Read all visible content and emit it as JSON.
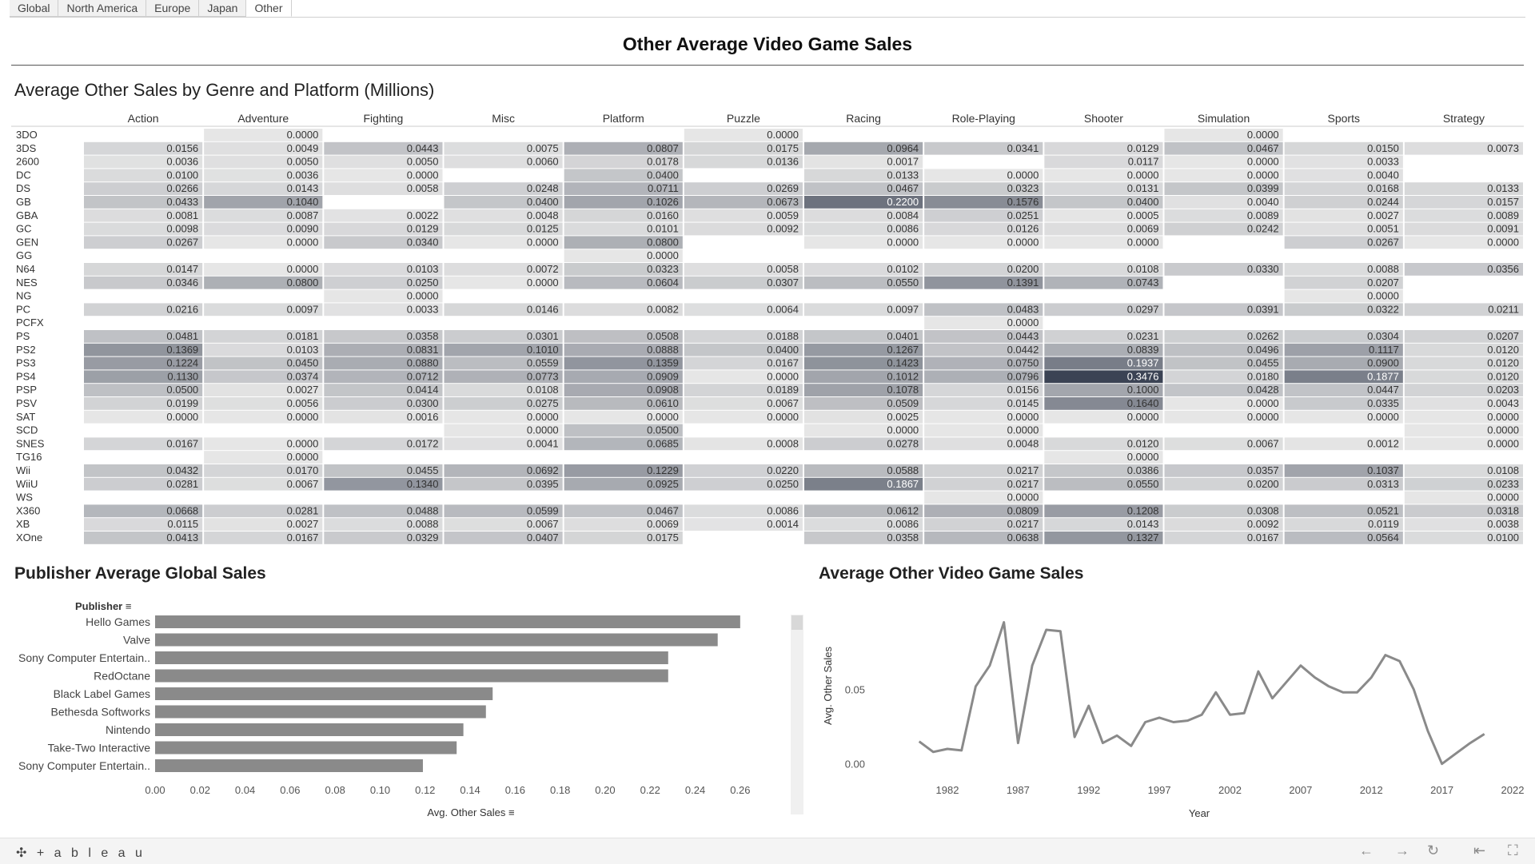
{
  "tabs": [
    "Global",
    "North America",
    "Europe",
    "Japan",
    "Other"
  ],
  "active_tab": 4,
  "dashboard_title": "Other Average Video Game Sales",
  "footer": {
    "logo": "+ a b l e a u",
    "logo_mark": "✣"
  },
  "chart_data": [
    {
      "type": "heatmap",
      "title": "Average Other Sales by Genre and Platform (Millions)",
      "columns": [
        "Action",
        "Adventure",
        "Fighting",
        "Misc",
        "Platform",
        "Puzzle",
        "Racing",
        "Role-Playing",
        "Shooter",
        "Simulation",
        "Sports",
        "Strategy"
      ],
      "rows": [
        "3DO",
        "3DS",
        "2600",
        "DC",
        "DS",
        "GB",
        "GBA",
        "GC",
        "GEN",
        "GG",
        "N64",
        "NES",
        "NG",
        "PC",
        "PCFX",
        "PS",
        "PS2",
        "PS3",
        "PS4",
        "PSP",
        "PSV",
        "SAT",
        "SCD",
        "SNES",
        "TG16",
        "Wii",
        "WiiU",
        "WS",
        "X360",
        "XB",
        "XOne"
      ],
      "values": [
        [
          null,
          0.0,
          null,
          null,
          null,
          0.0,
          null,
          null,
          null,
          0.0,
          null,
          null
        ],
        [
          0.0156,
          0.0049,
          0.0443,
          0.0075,
          0.0807,
          0.0175,
          0.0964,
          0.0341,
          0.0129,
          0.0467,
          0.015,
          0.0073
        ],
        [
          0.0036,
          0.005,
          0.005,
          0.006,
          0.0178,
          0.0136,
          0.0017,
          null,
          0.0117,
          0.0,
          0.0033,
          null
        ],
        [
          0.01,
          0.0036,
          0.0,
          null,
          0.04,
          null,
          0.0133,
          0.0,
          0.0,
          0.0,
          0.004,
          null
        ],
        [
          0.0266,
          0.0143,
          0.0058,
          0.0248,
          0.0711,
          0.0269,
          0.0467,
          0.0323,
          0.0131,
          0.0399,
          0.0168,
          0.0133
        ],
        [
          0.0433,
          0.104,
          null,
          0.04,
          0.1026,
          0.0673,
          0.22,
          0.1576,
          0.04,
          0.004,
          0.0244,
          0.0157
        ],
        [
          0.0081,
          0.0087,
          0.0022,
          0.0048,
          0.016,
          0.0059,
          0.0084,
          0.0251,
          0.0005,
          0.0089,
          0.0027,
          0.0089
        ],
        [
          0.0098,
          0.009,
          0.0129,
          0.0125,
          0.0101,
          0.0092,
          0.0086,
          0.0126,
          0.0069,
          0.0242,
          0.0051,
          0.0091
        ],
        [
          0.0267,
          0.0,
          0.034,
          0.0,
          0.08,
          null,
          0.0,
          0.0,
          0.0,
          null,
          0.0267,
          0.0
        ],
        [
          null,
          null,
          null,
          null,
          0.0,
          null,
          null,
          null,
          null,
          null,
          null,
          null
        ],
        [
          0.0147,
          0.0,
          0.0103,
          0.0072,
          0.0323,
          0.0058,
          0.0102,
          0.02,
          0.0108,
          0.033,
          0.0088,
          0.0356
        ],
        [
          0.0346,
          0.08,
          0.025,
          0.0,
          0.0604,
          0.0307,
          0.055,
          0.1391,
          0.0743,
          null,
          0.0207,
          null
        ],
        [
          null,
          null,
          0.0,
          null,
          null,
          null,
          null,
          null,
          null,
          null,
          0.0,
          null
        ],
        [
          0.0216,
          0.0097,
          0.0033,
          0.0146,
          0.0082,
          0.0064,
          0.0097,
          0.0483,
          0.0297,
          0.0391,
          0.0322,
          0.0211
        ],
        [
          null,
          null,
          null,
          null,
          null,
          null,
          null,
          0.0,
          null,
          null,
          null,
          null
        ],
        [
          0.0481,
          0.0181,
          0.0358,
          0.0301,
          0.0508,
          0.0188,
          0.0401,
          0.0443,
          0.0231,
          0.0262,
          0.0304,
          0.0207
        ],
        [
          0.1369,
          0.0103,
          0.0831,
          0.101,
          0.0888,
          0.04,
          0.1267,
          0.0442,
          0.0839,
          0.0496,
          0.1117,
          0.012
        ],
        [
          0.1224,
          0.045,
          0.088,
          0.0559,
          0.1359,
          0.0167,
          0.1423,
          0.075,
          0.1937,
          0.0455,
          0.09,
          0.012
        ],
        [
          0.113,
          0.0374,
          0.0712,
          0.0773,
          0.0909,
          0.0,
          0.1012,
          0.0796,
          0.3476,
          0.018,
          0.1877,
          0.012
        ],
        [
          0.05,
          0.0027,
          0.0414,
          0.0108,
          0.0908,
          0.0189,
          0.1078,
          0.0156,
          0.1,
          0.0428,
          0.0447,
          0.0203
        ],
        [
          0.0199,
          0.0056,
          0.03,
          0.0275,
          0.061,
          0.0067,
          0.0509,
          0.0145,
          0.164,
          0.0,
          0.0335,
          0.0043
        ],
        [
          0.0,
          0.0,
          0.0016,
          0.0,
          0.0,
          0.0,
          0.0025,
          0.0,
          0.0,
          0.0,
          0.0,
          0.0
        ],
        [
          null,
          null,
          null,
          0.0,
          0.05,
          null,
          0.0,
          0.0,
          null,
          null,
          null,
          0.0
        ],
        [
          0.0167,
          0.0,
          0.0172,
          0.0041,
          0.0685,
          0.0008,
          0.0278,
          0.0048,
          0.012,
          0.0067,
          0.0012,
          0.0
        ],
        [
          null,
          0.0,
          null,
          null,
          null,
          null,
          null,
          null,
          0.0,
          null,
          null,
          null
        ],
        [
          0.0432,
          0.017,
          0.0455,
          0.0692,
          0.1229,
          0.022,
          0.0588,
          0.0217,
          0.0386,
          0.0357,
          0.1037,
          0.0108
        ],
        [
          0.0281,
          0.0067,
          0.134,
          0.0395,
          0.0925,
          0.025,
          0.1867,
          0.0217,
          0.055,
          0.02,
          0.0313,
          0.0233
        ],
        [
          null,
          null,
          null,
          null,
          null,
          null,
          null,
          0.0,
          null,
          null,
          null,
          0.0
        ],
        [
          0.0668,
          0.0281,
          0.0488,
          0.0599,
          0.0467,
          0.0086,
          0.0612,
          0.0809,
          0.1208,
          0.0308,
          0.0521,
          0.0318
        ],
        [
          0.0115,
          0.0027,
          0.0088,
          0.0067,
          0.0069,
          0.0014,
          0.0086,
          0.0217,
          0.0143,
          0.0092,
          0.0119,
          0.0038
        ],
        [
          0.0413,
          0.0167,
          0.0329,
          0.0407,
          0.0175,
          null,
          0.0358,
          0.0638,
          0.1327,
          0.0167,
          0.0564,
          0.01
        ]
      ],
      "color_low": "#e6e6e6",
      "color_high": "#3b4354"
    },
    {
      "type": "bar",
      "orientation": "horizontal",
      "title": "Publisher Average Global Sales",
      "category_header": "Publisher",
      "categories": [
        "Hello Games",
        "Valve",
        "Sony Computer Entertain..",
        "RedOctane",
        "Black Label Games",
        "Bethesda Softworks",
        "Nintendo",
        "Take-Two Interactive",
        "Sony Computer Entertain.."
      ],
      "values": [
        0.26,
        0.25,
        0.228,
        0.228,
        0.15,
        0.147,
        0.137,
        0.134,
        0.119
      ],
      "xlabel": "Avg. Other Sales",
      "xlim": [
        0,
        0.27
      ],
      "xticks": [
        "0.00",
        "0.02",
        "0.04",
        "0.06",
        "0.08",
        "0.10",
        "0.12",
        "0.14",
        "0.16",
        "0.18",
        "0.20",
        "0.22",
        "0.24",
        "0.26"
      ],
      "color": "#8a8a8a"
    },
    {
      "type": "line",
      "title": "Average Other Video Game Sales",
      "xlabel": "Year",
      "ylabel": "Avg. Other Sales",
      "x": [
        1980,
        1981,
        1982,
        1983,
        1984,
        1985,
        1986,
        1987,
        1988,
        1989,
        1990,
        1991,
        1992,
        1993,
        1994,
        1995,
        1996,
        1997,
        1998,
        1999,
        2000,
        2001,
        2002,
        2003,
        2004,
        2005,
        2006,
        2007,
        2008,
        2009,
        2010,
        2011,
        2012,
        2013,
        2014,
        2015,
        2016,
        2017,
        2018,
        2019,
        2020
      ],
      "y": [
        0.015,
        0.008,
        0.01,
        0.009,
        0.052,
        0.066,
        0.095,
        0.014,
        0.066,
        0.09,
        0.089,
        0.018,
        0.039,
        0.014,
        0.019,
        0.012,
        0.028,
        0.031,
        0.028,
        0.029,
        0.033,
        0.048,
        0.033,
        0.034,
        0.062,
        0.044,
        0.055,
        0.066,
        0.058,
        0.052,
        0.048,
        0.048,
        0.058,
        0.073,
        0.069,
        0.05,
        0.022,
        0.0,
        0.007,
        0.014,
        0.02
      ],
      "xlim": [
        1979,
        2022
      ],
      "ylim": [
        -0.005,
        0.105
      ],
      "xticks": [
        1982,
        1987,
        1992,
        1997,
        2002,
        2007,
        2012,
        2017,
        2022
      ],
      "yticks": [
        "0.00",
        "0.05"
      ],
      "color": "#8a8a8a"
    }
  ]
}
